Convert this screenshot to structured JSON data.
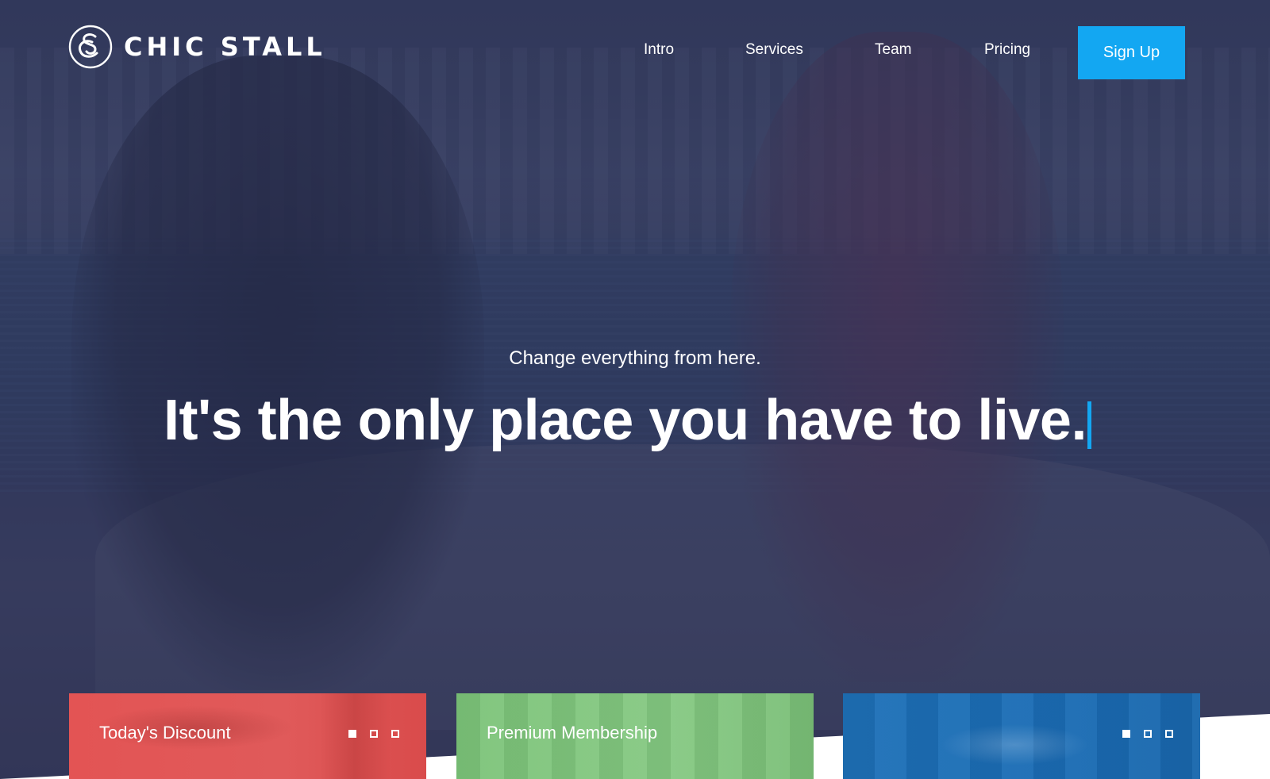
{
  "brand": {
    "name": "CHIC STALL",
    "logo_icon": "cs-monogram-icon"
  },
  "nav": {
    "items": [
      {
        "label": "Intro"
      },
      {
        "label": "Services"
      },
      {
        "label": "Team"
      },
      {
        "label": "Pricing"
      }
    ],
    "cta_label": "Sign Up"
  },
  "hero": {
    "subtitle": "Change everything from here.",
    "headline": "It's the only place you have to live."
  },
  "cards": [
    {
      "title": "Today's Discount",
      "color": "#e35454"
    },
    {
      "title": "Premium Membership",
      "color": "#7dc47a"
    },
    {
      "title": "",
      "color": "#1f72b8"
    }
  ],
  "colors": {
    "accent": "#13a7f2",
    "overlay": "#2a3052"
  }
}
